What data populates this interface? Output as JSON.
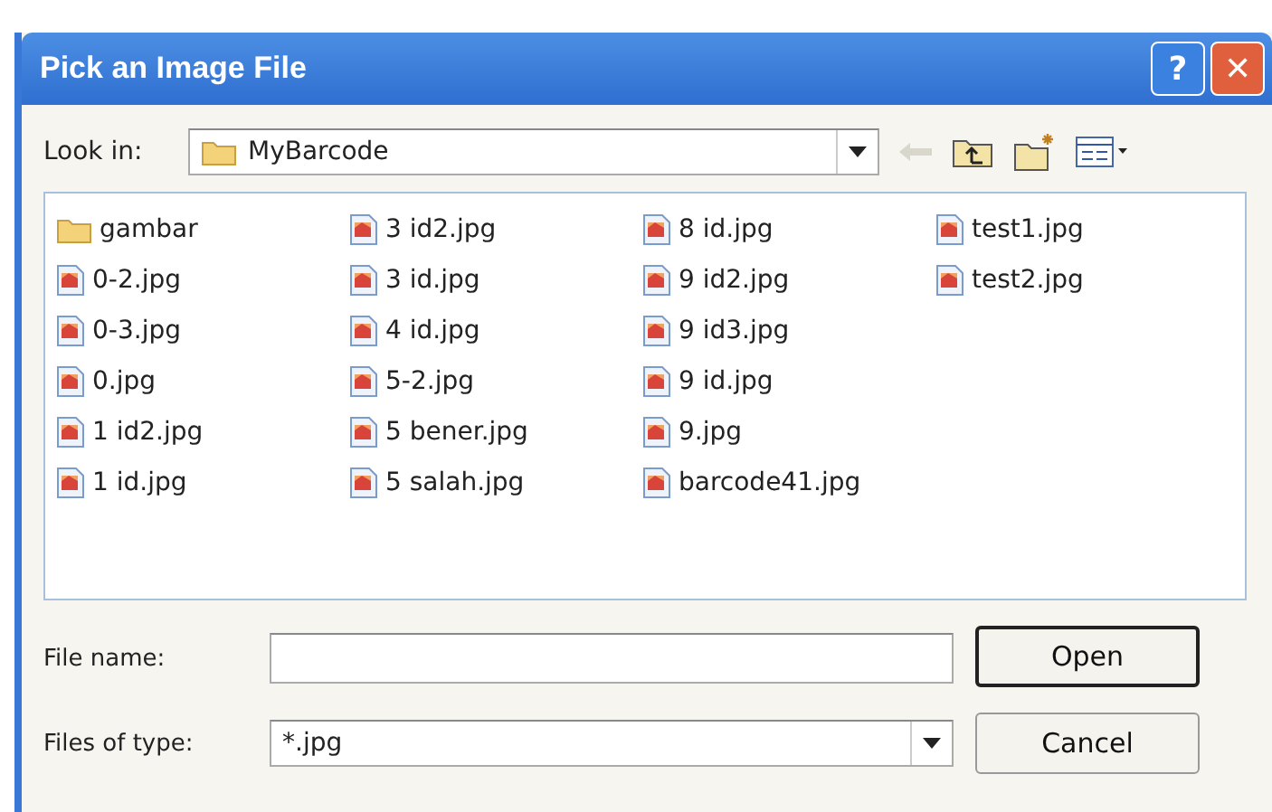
{
  "window": {
    "title": "Pick an Image File",
    "title_buttons": [
      {
        "kind": "help",
        "label": "?"
      },
      {
        "kind": "close",
        "label": "✕"
      }
    ]
  },
  "look_in": {
    "label": "Look in:",
    "value": "MyBarcode"
  },
  "files": [
    {
      "name": "gambar",
      "kind": "folder"
    },
    {
      "name": "0-2.jpg",
      "kind": "image"
    },
    {
      "name": "0-3.jpg",
      "kind": "image"
    },
    {
      "name": "0.jpg",
      "kind": "image"
    },
    {
      "name": "1 id2.jpg",
      "kind": "image"
    },
    {
      "name": "1 id.jpg",
      "kind": "image"
    },
    {
      "name": "3 id2.jpg",
      "kind": "image"
    },
    {
      "name": "3 id.jpg",
      "kind": "image"
    },
    {
      "name": "4 id.jpg",
      "kind": "image"
    },
    {
      "name": "5-2.jpg",
      "kind": "image"
    },
    {
      "name": "5 bener.jpg",
      "kind": "image"
    },
    {
      "name": "5 salah.jpg",
      "kind": "image"
    },
    {
      "name": "8 id.jpg",
      "kind": "image"
    },
    {
      "name": "9 id2.jpg",
      "kind": "image"
    },
    {
      "name": "9 id3.jpg",
      "kind": "image"
    },
    {
      "name": "9 id.jpg",
      "kind": "image"
    },
    {
      "name": "9.jpg",
      "kind": "image"
    },
    {
      "name": "barcode41.jpg",
      "kind": "image"
    },
    {
      "name": "test1.jpg",
      "kind": "image"
    },
    {
      "name": "test2.jpg",
      "kind": "image"
    }
  ],
  "file_name": {
    "label": "File name:"
  },
  "file_type": {
    "label": "Files of type:",
    "value": "*.jpg"
  },
  "buttons": [
    {
      "label": "Open",
      "kind": "default"
    },
    {
      "label": "Cancel",
      "kind": "normal"
    }
  ]
}
